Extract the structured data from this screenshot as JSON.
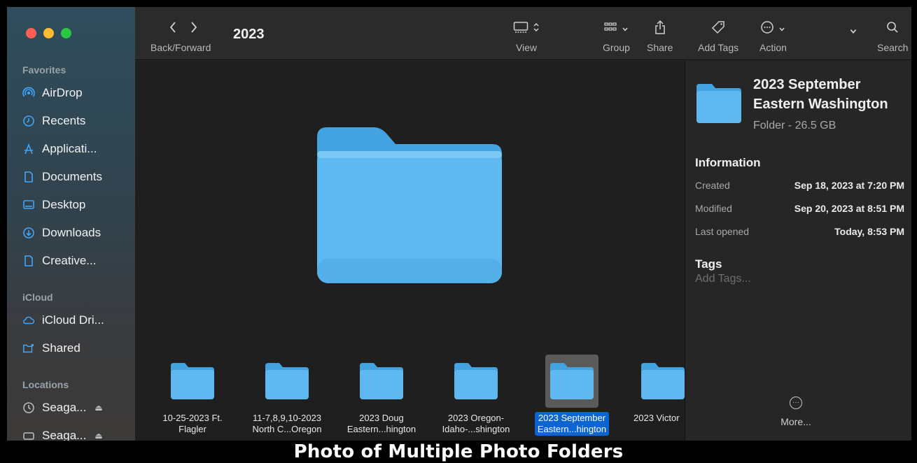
{
  "window": {
    "title": "2023"
  },
  "sidebar": {
    "favorites_label": "Favorites",
    "favorites": [
      {
        "label": "AirDrop",
        "icon": "airdrop-icon"
      },
      {
        "label": "Recents",
        "icon": "clock-icon"
      },
      {
        "label": "Applicati...",
        "icon": "applications-icon"
      },
      {
        "label": "Documents",
        "icon": "document-icon"
      },
      {
        "label": "Desktop",
        "icon": "desktop-icon"
      },
      {
        "label": "Downloads",
        "icon": "download-icon"
      },
      {
        "label": "Creative...",
        "icon": "file-icon"
      }
    ],
    "icloud_label": "iCloud",
    "icloud": [
      {
        "label": "iCloud Dri...",
        "icon": "cloud-icon"
      },
      {
        "label": "Shared",
        "icon": "shared-folder-icon"
      }
    ],
    "locations_label": "Locations",
    "locations": [
      {
        "label": "Seaga...",
        "icon": "time-machine-icon"
      },
      {
        "label": "Seaga...",
        "icon": "drive-icon"
      }
    ]
  },
  "toolbar": {
    "back_forward": "Back/Forward",
    "view": "View",
    "group": "Group",
    "share": "Share",
    "add_tags": "Add Tags",
    "action": "Action",
    "search": "Search"
  },
  "files": [
    {
      "line1": "10-25-2023 Ft.",
      "line2": "Flagler",
      "selected": false
    },
    {
      "line1": "11-7,8,9,10-2023",
      "line2": "North C...Oregon",
      "selected": false
    },
    {
      "line1": "2023 Doug",
      "line2": "Eastern...hington",
      "selected": false
    },
    {
      "line1": "2023 Oregon-",
      "line2": "Idaho-...shington",
      "selected": false
    },
    {
      "line1": "2023 September",
      "line2": "Eastern...hington",
      "selected": true
    },
    {
      "line1": "2023 Victor",
      "line2": "",
      "selected": false
    }
  ],
  "inspector": {
    "name_line1": "2023 September",
    "name_line2": "Eastern Washington",
    "kind": "Folder - 26.5 GB",
    "information_label": "Information",
    "created_label": "Created",
    "created_value": "Sep 18, 2023 at 7:20 PM",
    "modified_label": "Modified",
    "modified_value": "Sep 20, 2023 at 8:51 PM",
    "opened_label": "Last opened",
    "opened_value": "Today, 8:53 PM",
    "tags_label": "Tags",
    "tags_placeholder": "Add Tags...",
    "more_label": "More..."
  },
  "caption": "Photo of Multiple Photo Folders",
  "colors": {
    "folder": "#5fb9f0",
    "folder_tab": "#43a3e0",
    "selection": "#0a64d1",
    "accent": "#3ea6ff"
  }
}
